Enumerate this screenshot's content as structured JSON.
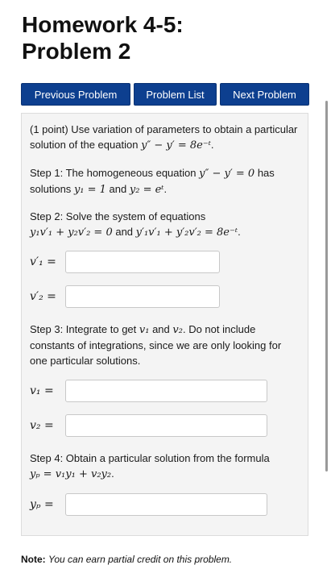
{
  "page": {
    "title_line1": "Homework 4-5:",
    "title_line2": "Problem 2"
  },
  "nav": {
    "previous": "Previous Problem",
    "list": "Problem List",
    "next": "Next Problem"
  },
  "problem": {
    "intro": "(1 point) Use variation of parameters to obtain a particular solution of the equation",
    "eq_main": "y″ − y′ = 8e⁻ᵗ",
    "step1_text": "Step 1: The homogeneous equation",
    "step1_eq": "y″ − y′ = 0",
    "step1_has": "has solutions",
    "step1_y1": "y₁ = 1",
    "step1_and": "and",
    "step1_y2": "y₂ = eᵗ",
    "step2_text": "Step 2: Solve the system of equations",
    "step2_eq1": "y₁v′₁ + y₂v′₂ = 0",
    "step2_and": "and",
    "step2_eq2": "y′₁v′₁ + y′₂v′₂ = 8e⁻ᵗ",
    "step3_text_a": "Step 3: Integrate to get",
    "step3_v1": "v₁",
    "step3_and": "and",
    "step3_v2": "v₂",
    "step3_text_b": ". Do not include constants of integrations, since we are only looking for one particular solutions.",
    "step4_text": "Step 4: Obtain a particular solution from the formula",
    "step4_eq": "yₚ = v₁y₁ + v₂y₂"
  },
  "answers": {
    "v1prime_label": "v′₁ =",
    "v1prime_value": "",
    "v2prime_label": "v′₂ =",
    "v2prime_value": "",
    "v1_label": "v₁ =",
    "v1_value": "",
    "v2_label": "v₂ =",
    "v2_value": "",
    "yp_label": "yₚ =",
    "yp_value": ""
  },
  "note": {
    "label": "Note:",
    "text": "You can earn partial credit on this problem."
  }
}
